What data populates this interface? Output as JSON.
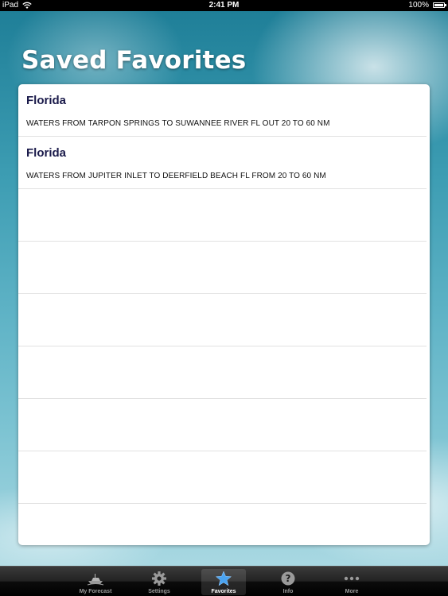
{
  "status_bar": {
    "carrier": "iPad",
    "time": "2:41 PM",
    "battery": "100%",
    "battery_level": 1.0
  },
  "page": {
    "title": "Saved Favorites"
  },
  "favorites": [
    {
      "title": "Florida",
      "subtitle": "WATERS FROM TARPON SPRINGS TO SUWANNEE RIVER FL OUT 20 TO 60 NM"
    },
    {
      "title": "Florida",
      "subtitle": "WATERS FROM JUPITER INLET TO DEERFIELD BEACH FL FROM 20 TO 60 NM"
    }
  ],
  "tab_bar": {
    "selected": "favorites",
    "items": [
      {
        "id": "my-forecast",
        "label": "My Forecast",
        "icon": "boat-icon"
      },
      {
        "id": "settings",
        "label": "Settings",
        "icon": "gear-icon"
      },
      {
        "id": "favorites",
        "label": "Favorites",
        "icon": "star-icon"
      },
      {
        "id": "info",
        "label": "Info",
        "icon": "question-icon"
      },
      {
        "id": "more",
        "label": "More",
        "icon": "more-dots-icon"
      }
    ]
  },
  "colors": {
    "selected_tab_icon": "#4aa3f0",
    "inactive_tab_icon": "#9a9a9a",
    "row_title": "#1a1a4a"
  }
}
